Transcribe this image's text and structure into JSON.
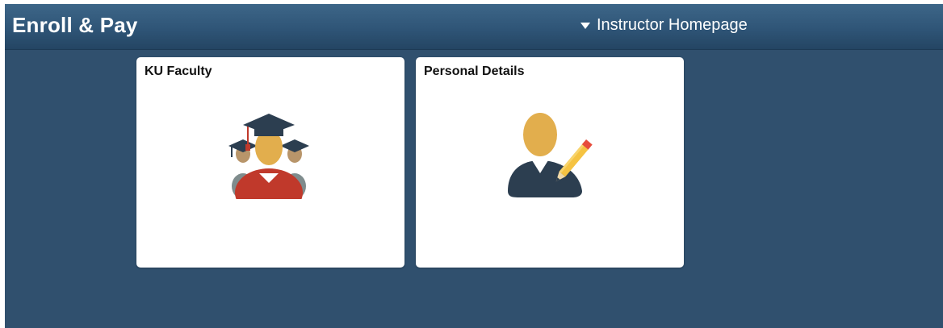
{
  "header": {
    "app_title": "Enroll & Pay",
    "homepage_selector_label": "Instructor Homepage"
  },
  "tiles": [
    {
      "title": "KU Faculty",
      "icon": "faculty-graduates-icon"
    },
    {
      "title": "Personal Details",
      "icon": "person-edit-icon"
    }
  ],
  "colors": {
    "page_background": "#30506e",
    "header_top": "#3d6688",
    "header_bottom": "#244563",
    "tile_background": "#ffffff",
    "skin": "#e2ae4d",
    "robe_red": "#c0392b",
    "cap_navy": "#2c3e50",
    "pencil_yellow": "#f5c342"
  }
}
